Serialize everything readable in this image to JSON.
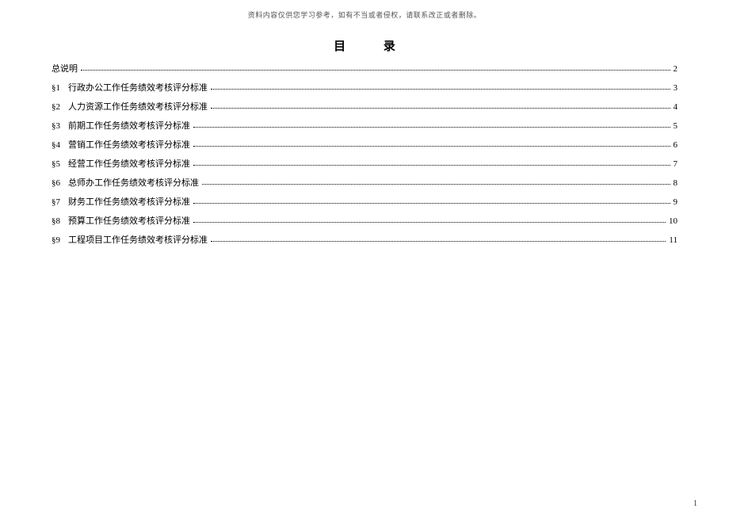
{
  "header_note": "资料内容仅供您学习参考，如有不当或者侵权，请联系改正或者删除。",
  "title": "目 录",
  "toc": {
    "items": [
      {
        "prefix": "",
        "label": "总说明",
        "page": "2"
      },
      {
        "prefix": "§1",
        "label": "行政办公工作任务绩效考核评分标准",
        "page": "3"
      },
      {
        "prefix": "§2",
        "label": "人力资源工作任务绩效考核评分标准",
        "page": "4"
      },
      {
        "prefix": "§3",
        "label": "前期工作任务绩效考核评分标准",
        "page": "5"
      },
      {
        "prefix": "§4",
        "label": "营销工作任务绩效考核评分标准",
        "page": "6"
      },
      {
        "prefix": "§5",
        "label": "经营工作任务绩效考核评分标准",
        "page": "7"
      },
      {
        "prefix": "§6",
        "label": "总师办工作任务绩效考核评分标准",
        "page": "8"
      },
      {
        "prefix": "§7",
        "label": "财务工作任务绩效考核评分标准",
        "page": "9"
      },
      {
        "prefix": "§8",
        "label": "预算工作任务绩效考核评分标准",
        "page": "10"
      },
      {
        "prefix": "§9",
        "label": "工程项目工作任务绩效考核评分标准",
        "page": "11"
      }
    ]
  },
  "page_number": "1"
}
